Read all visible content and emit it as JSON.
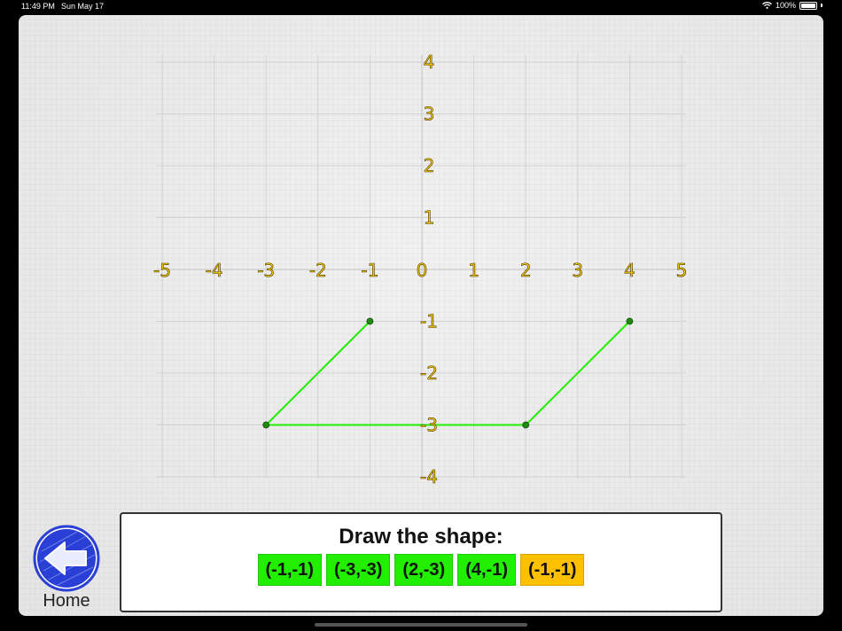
{
  "status_bar": {
    "time": "11:49 PM",
    "date": "Sun May 17",
    "battery": "100%",
    "battery_level": 1.0
  },
  "graph": {
    "x_ticks": [
      "-5",
      "-4",
      "-3",
      "-2",
      "-1",
      "0",
      "1",
      "2",
      "3",
      "4",
      "5"
    ],
    "y_ticks": [
      "4",
      "3",
      "2",
      "1",
      "-1",
      "-2",
      "-3",
      "-4"
    ],
    "x_range": [
      -5,
      5
    ],
    "y_range": [
      -4,
      4
    ],
    "drawn_points": [
      [
        -1,
        -1
      ],
      [
        -3,
        -3
      ],
      [
        2,
        -3
      ],
      [
        4,
        -1
      ]
    ],
    "line_color": "#22ee00",
    "point_color": "#1e8a10",
    "label_color": "#f5c800"
  },
  "home": {
    "label": "Home",
    "icon": "back-arrow-icon",
    "color": "#2a3fd6"
  },
  "prompt": {
    "title": "Draw the shape:",
    "points": [
      {
        "label": "(-1,-1)",
        "state": "done"
      },
      {
        "label": "(-3,-3)",
        "state": "done"
      },
      {
        "label": "(2,-3)",
        "state": "done"
      },
      {
        "label": "(4,-1)",
        "state": "done"
      },
      {
        "label": "(-1,-1)",
        "state": "current"
      }
    ],
    "colors": {
      "done": "#22ee00",
      "current": "#ffc000"
    }
  }
}
